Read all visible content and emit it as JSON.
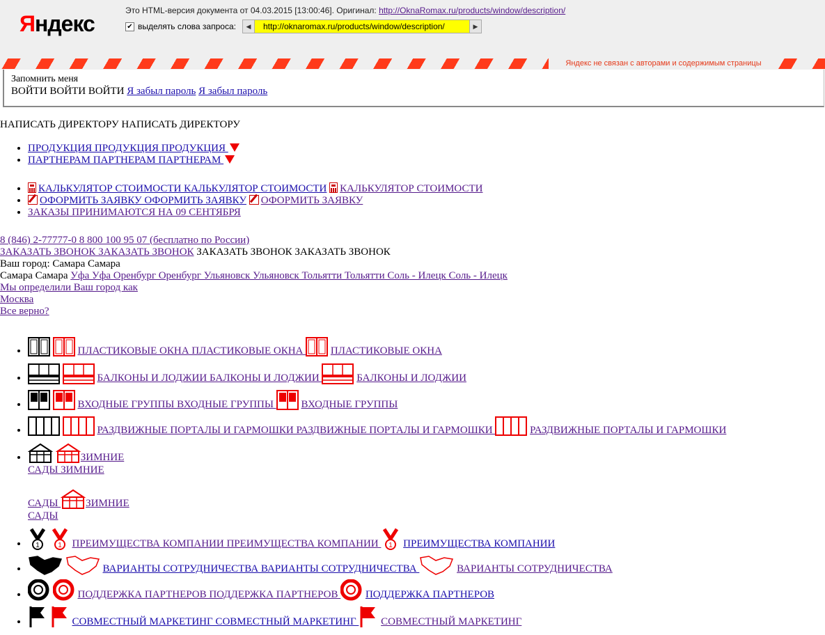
{
  "yandex": {
    "logo_first": "Я",
    "logo_rest": "ндекс",
    "note_prefix": "Это HTML-версия документа от 04.03.2015 [13:00:46]. Оригинал:",
    "original_url": "http://OknaRomax.ru/products/window/description/",
    "highlight_label": "выделять слова запроса:",
    "highlight_checked": "✔",
    "url_field": "http://oknaromax.ru/products/window/description/",
    "prev": "◀",
    "next": "▶",
    "disclaimer": "Яндекс не связан с авторами и содержимым страницы"
  },
  "login": {
    "remember": "Запомнить меня",
    "enter_text": "ВОЙТИ ВОЙТИ ВОЙТИ",
    "forgot_1": "Я забыл пароль",
    "forgot_2": "Я забыл пароль"
  },
  "write_director": "НАПИСАТЬ ДИРЕКТОРУ НАПИСАТЬ ДИРЕКТОРУ",
  "menu1": [
    {
      "label": "ПРОДУКЦИЯ ПРОДУКЦИЯ ПРОДУКЦИЯ "
    },
    {
      "label": "ПАРТНЕРАМ ПАРТНЕРАМ ПАРТНЕРАМ "
    }
  ],
  "menu2": {
    "calc_1": "КАЛЬКУЛЯТОР СТОИМОСТИ КАЛЬКУЛЯТОР СТОИМОСТИ",
    "calc_2": "КАЛЬКУЛЯТОР СТОИМОСТИ",
    "order_1": "ОФОРМИТЬ ЗАЯВКУ ОФОРМИТЬ ЗАЯВКУ",
    "order_2": "ОФОРМИТЬ ЗАЯВКУ",
    "orders_date": "ЗАКАЗЫ ПРИНИМАЮТСЯ НА 09 СЕНТЯБРЯ"
  },
  "contacts": {
    "phones": "8 (846) 2-77777-0 8 800 100 95 07 (бесплатно по России)",
    "callback_link": "ЗАКАЗАТЬ ЗВОНОК ЗАКАЗАТЬ ЗВОНОК",
    "callback_text": " ЗАКАЗАТЬ ЗВОНОК ЗАКАЗАТЬ ЗВОНОК",
    "city_line": "Ваш город: Самара Самара",
    "city_current": "Самара Самара ",
    "cities": "Уфа Уфа Оренбург Оренбург Ульяновск Ульяновск Тольятти Тольятти Соль - Илецк Соль - Илецк",
    "detected": "Мы определили Ваш город как",
    "moscow": "Москва",
    "correct": "Все верно?"
  },
  "categories": {
    "windows": {
      "l1": "ПЛАСТИКОВЫЕ ОКНА ПЛАСТИКОВЫЕ ОКНА ",
      "l2": "ПЛАСТИКОВЫЕ ОКНА"
    },
    "balcony": {
      "l1": "БАЛКОНЫ И ЛОДЖИИ БАЛКОНЫ И ЛОДЖИИ ",
      "l2": "БАЛКОНЫ И ЛОДЖИИ"
    },
    "entrance": {
      "l1": "ВХОДНЫЕ ГРУППЫ ВХОДНЫЕ ГРУППЫ ",
      "l2": "ВХОДНЫЕ ГРУППЫ"
    },
    "portals": {
      "l1": "РАЗДВИЖНЫЕ ПОРТАЛЫ И ГАРМОШКИ РАЗДВИЖНЫЕ ПОРТАЛЫ И ГАРМОШКИ ",
      "l2": "РАЗДВИЖНЫЕ ПОРТАЛЫ И ГАРМОШКИ"
    },
    "gardens": {
      "a": "ЗИМНИЕ ",
      "b": "САДЫ ЗИМНИЕ ",
      "c": "САДЫ ",
      "d": "ЗИМНИЕ ",
      "e": "САДЫ"
    }
  },
  "features": {
    "advantages": {
      "l1": "ПРЕИМУЩЕСТВА КОМПАНИИ ПРЕИМУЩЕСТВА КОМПАНИИ ",
      "l2": "ПРЕИМУЩЕСТВА КОМПАНИИ"
    },
    "cooperation": {
      "l1": "ВАРИАНТЫ СОТРУДНИЧЕСТВА ВАРИАНТЫ СОТРУДНИЧЕСТВА ",
      "l2": "ВАРИАНТЫ СОТРУДНИЧЕСТВА"
    },
    "support": {
      "l1": "ПОДДЕРЖКА ПАРТНЕРОВ ПОДДЕРЖКА ПАРТНЕРОВ ",
      "l2": "ПОДДЕРЖКА ПАРТНЕРОВ"
    },
    "marketing": {
      "l1": "СОВМЕСТНЫЙ МАРКЕТИНГ СОВМЕСТНЫЙ МАРКЕТИНГ ",
      "l2": "СОВМЕСТНЫЙ МАРКЕТИНГ"
    }
  },
  "colors": {
    "accent": "#e00000",
    "link": "#1a0dab",
    "visited": "#551a8b",
    "highlight": "#ffff00"
  }
}
